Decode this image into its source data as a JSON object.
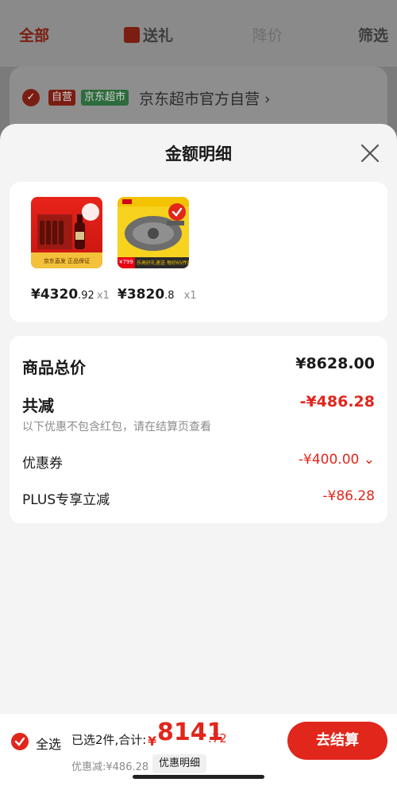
{
  "background": {
    "tabs": [
      "全部",
      "送礼",
      "降价",
      "筛选"
    ],
    "badge_self": "自营",
    "badge_market": "京东超市",
    "shop_name": "京东超市官方自营 ›"
  },
  "sheet": {
    "title": "金额明细",
    "close_icon": "close-icon"
  },
  "products": [
    {
      "price_int": "¥4320",
      "price_dec": ".92",
      "qty": "x1",
      "thumb_caption": "京东直发 正品保证"
    },
    {
      "price_int": "¥3820",
      "price_dec": ".8",
      "qty": "x1",
      "thumb_tag": "¥799",
      "thumb_caption": "乐高好礼速送 每好65件起"
    }
  ],
  "summary": {
    "total_label": "商品总价",
    "total_value": "¥8628.00",
    "discount_label": "共减",
    "discount_value": "-¥486.28",
    "note": "以下优惠不包含红包，请在结算页查看",
    "coupon_label": "优惠券",
    "coupon_value": "-¥400.00 ⌄",
    "plus_label": "PLUS专享立减",
    "plus_value": "-¥86.28"
  },
  "bottom": {
    "select_all": "全选",
    "selected_text": "已选2件,合计:",
    "total_currency": "¥",
    "total_int": "8141",
    "total_dec": ".72",
    "discount_text": "优惠减:¥486.28",
    "detail_button": "优惠明细",
    "checkout_button": "去结算"
  },
  "colors": {
    "accent": "#e1261c",
    "sheet_bg": "#f4f4f4",
    "card_bg": "#ffffff"
  }
}
